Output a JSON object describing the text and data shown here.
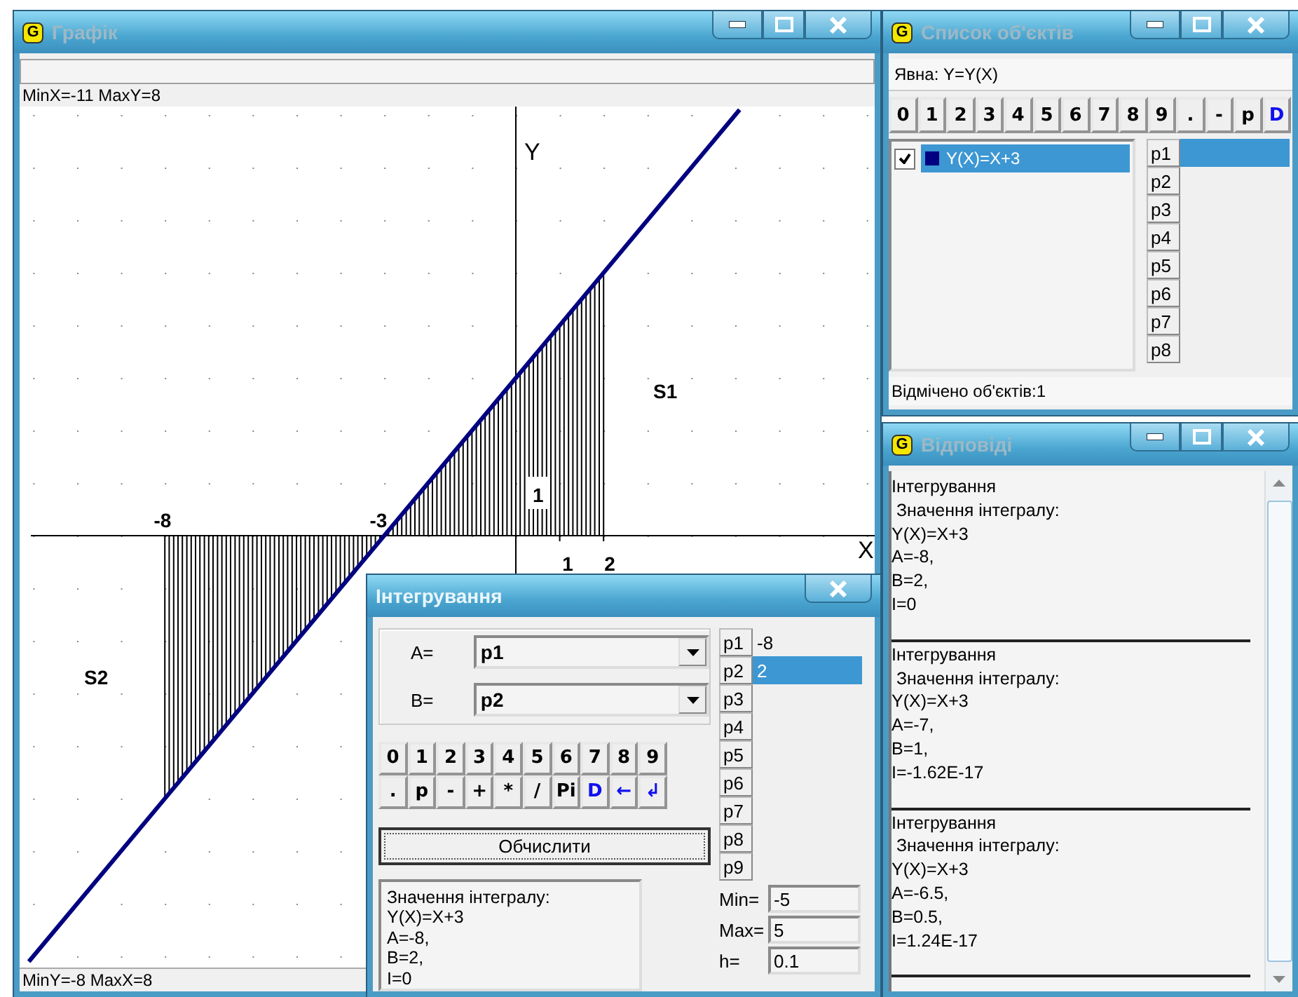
{
  "graph_window": {
    "title": "Графік",
    "icon_letter": "G",
    "status_top": "MinX=-11  MaxY=8",
    "status_bottom": "MinY=-8  MaxX=8",
    "plot": {
      "shaded": true,
      "axis_labels": [
        "X",
        "Y"
      ],
      "tick_labels": [
        "-8",
        "-3",
        "1",
        "2",
        "1"
      ],
      "area_labels": [
        "S1",
        "S2"
      ]
    }
  },
  "objects_window": {
    "title": "Список об'єктів",
    "icon_letter": "G",
    "type_label": "Явна: Y=Y(X)",
    "keys": [
      {
        "label": "0",
        "kind": "plain"
      },
      {
        "label": "1",
        "kind": "plain"
      },
      {
        "label": "2",
        "kind": "plain"
      },
      {
        "label": "3",
        "kind": "plain"
      },
      {
        "label": "4",
        "kind": "plain"
      },
      {
        "label": "5",
        "kind": "plain"
      },
      {
        "label": "6",
        "kind": "plain"
      },
      {
        "label": "7",
        "kind": "plain"
      },
      {
        "label": "8",
        "kind": "plain"
      },
      {
        "label": "9",
        "kind": "plain"
      },
      {
        "label": ".",
        "kind": "plain"
      },
      {
        "label": "-",
        "kind": "plain"
      },
      {
        "label": "p",
        "kind": "plain"
      },
      {
        "label": "D",
        "kind": "accent"
      }
    ],
    "objects": [
      {
        "label": "Y(X)=X+3",
        "checked": true,
        "selected": true,
        "color": "#000080"
      }
    ],
    "params": [
      {
        "label": "p1",
        "selected": true
      },
      {
        "label": "p2",
        "selected": false
      },
      {
        "label": "p3",
        "selected": false
      },
      {
        "label": "p4",
        "selected": false
      },
      {
        "label": "p5",
        "selected": false
      },
      {
        "label": "p6",
        "selected": false
      },
      {
        "label": "p7",
        "selected": false
      },
      {
        "label": "p8",
        "selected": false
      }
    ],
    "status": "Відмічено об'єктів:1"
  },
  "answers_window": {
    "title": "Відповіді",
    "icon_letter": "G",
    "entries": [
      {
        "lines": [
          "Інтегрування",
          " Значення інтегралу:",
          "Y(X)=X+3",
          "A=-8,",
          "B=2,",
          "I=0"
        ]
      },
      {
        "lines": [
          "Інтегрування",
          " Значення інтегралу:",
          "Y(X)=X+3",
          "A=-7,",
          "B=1,",
          "I=-1.62E-17"
        ]
      },
      {
        "lines": [
          "Інтегрування",
          " Значення інтегралу:",
          "Y(X)=X+3",
          "A=-6.5,",
          "B=0.5,",
          "I=1.24E-17"
        ]
      }
    ]
  },
  "integration_dialog": {
    "title": "Інтегрування",
    "fields": [
      {
        "label": "A=",
        "value": "p1"
      },
      {
        "label": "B=",
        "value": "p2"
      }
    ],
    "keys": [
      {
        "label": "0",
        "kind": "plain"
      },
      {
        "label": "1",
        "kind": "plain"
      },
      {
        "label": "2",
        "kind": "plain"
      },
      {
        "label": "3",
        "kind": "plain"
      },
      {
        "label": "4",
        "kind": "plain"
      },
      {
        "label": "5",
        "kind": "plain"
      },
      {
        "label": "6",
        "kind": "plain"
      },
      {
        "label": "7",
        "kind": "plain"
      },
      {
        "label": "8",
        "kind": "plain"
      },
      {
        "label": "9",
        "kind": "plain"
      },
      {
        "label": ".",
        "kind": "plain"
      },
      {
        "label": "p",
        "kind": "plain"
      },
      {
        "label": "-",
        "kind": "plain"
      },
      {
        "label": "+",
        "kind": "plain"
      },
      {
        "label": "*",
        "kind": "plain"
      },
      {
        "label": "/",
        "kind": "plain"
      },
      {
        "label": "Pi",
        "kind": "plain"
      },
      {
        "label": "D",
        "kind": "accent"
      },
      {
        "label": "←",
        "kind": "accent"
      },
      {
        "label": "↲",
        "kind": "accent"
      }
    ],
    "compute_button": "Обчислити",
    "result_lines": [
      "Значення інтегралу:",
      "Y(X)=X+3",
      "A=-8,",
      "B=2,",
      "I=0"
    ],
    "params": [
      {
        "label": "p1",
        "value": "-8",
        "selected": false
      },
      {
        "label": "p2",
        "value": "2",
        "selected": true
      },
      {
        "label": "p3",
        "selected": false
      },
      {
        "label": "p4",
        "selected": false
      },
      {
        "label": "p5",
        "selected": false
      },
      {
        "label": "p6",
        "selected": false
      },
      {
        "label": "p7",
        "selected": false
      },
      {
        "label": "p8",
        "selected": false
      },
      {
        "label": "p9",
        "selected": false
      }
    ],
    "ranges": [
      {
        "label": "Min=",
        "value": "-5"
      },
      {
        "label": "Max=",
        "value": "5"
      },
      {
        "label": "h=",
        "value": "0.1"
      }
    ]
  }
}
